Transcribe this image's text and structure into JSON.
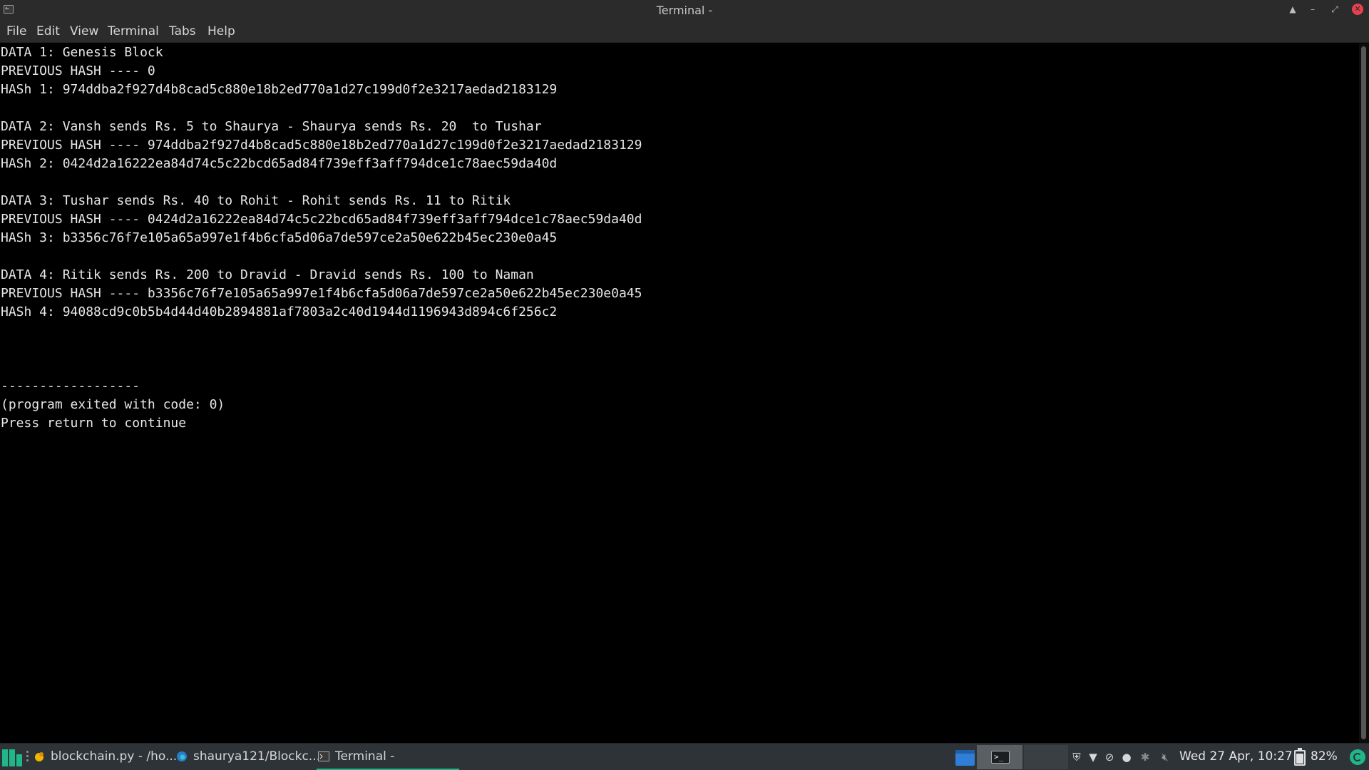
{
  "window": {
    "title": "Terminal -",
    "controls": [
      "eject",
      "minimize",
      "maximize",
      "close"
    ]
  },
  "menubar": {
    "items": [
      "File",
      "Edit",
      "View",
      "Terminal",
      "Tabs",
      "Help"
    ]
  },
  "terminal": {
    "lines": [
      "DATA 1: Genesis Block",
      "PREVIOUS HASH ---- 0",
      "HASh 1: 974ddba2f927d4b8cad5c880e18b2ed770a1d27c199d0f2e3217aedad2183129",
      "",
      "DATA 2: Vansh sends Rs. 5 to Shaurya - Shaurya sends Rs. 20  to Tushar",
      "PREVIOUS HASH ---- 974ddba2f927d4b8cad5c880e18b2ed770a1d27c199d0f2e3217aedad2183129",
      "HASh 2: 0424d2a16222ea84d74c5c22bcd65ad84f739eff3aff794dce1c78aec59da40d",
      "",
      "DATA 3: Tushar sends Rs. 40 to Rohit - Rohit sends Rs. 11 to Ritik",
      "PREVIOUS HASH ---- 0424d2a16222ea84d74c5c22bcd65ad84f739eff3aff794dce1c78aec59da40d",
      "HASh 3: b3356c76f7e105a65a997e1f4b6cfa5d06a7de597ce2a50e622b45ec230e0a45",
      "",
      "DATA 4: Ritik sends Rs. 200 to Dravid - Dravid sends Rs. 100 to Naman",
      "PREVIOUS HASH ---- b3356c76f7e105a65a997e1f4b6cfa5d06a7de597ce2a50e622b45ec230e0a45",
      "HASh 4: 94088cd9c0b5b4d44d40b2894881af7803a2c40d1944d1196943d894c6f256c2",
      "",
      "",
      "",
      "------------------",
      "(program exited with code: 0)",
      "Press return to continue"
    ]
  },
  "taskbar": {
    "tasks": [
      {
        "label": "blockchain.py - /ho...",
        "icon": "geany-icon"
      },
      {
        "label": "shaurya121/Blockc...",
        "icon": "browser-icon"
      },
      {
        "label": "Terminal -",
        "icon": "terminal-icon",
        "active": true
      }
    ],
    "tray_icons": [
      "shield-icon",
      "wifi-icon",
      "attachment-icon",
      "mail-icon",
      "bluetooth-icon",
      "volume-muted-icon"
    ],
    "clock": "Wed 27 Apr, 10:27",
    "battery": "82%",
    "accent_color": "#1fb789"
  }
}
